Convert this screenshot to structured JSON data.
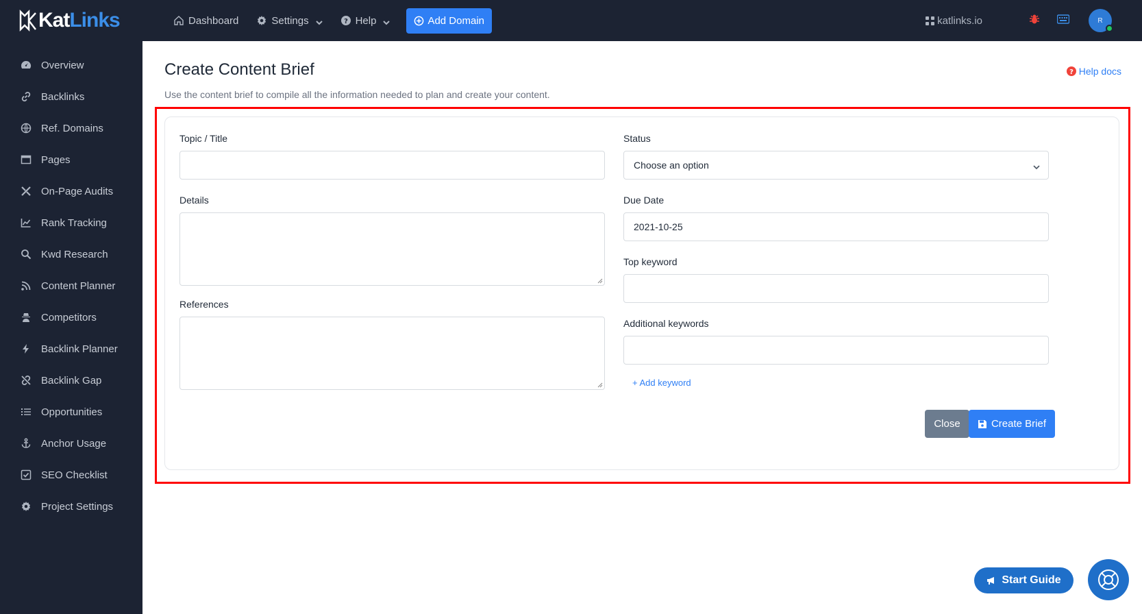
{
  "brand": {
    "name_a": "Kat",
    "name_b": "Links"
  },
  "sidebar": {
    "items": [
      {
        "label": "Overview",
        "icon": "gauge-icon"
      },
      {
        "label": "Backlinks",
        "icon": "link-icon"
      },
      {
        "label": "Ref. Domains",
        "icon": "globe-icon"
      },
      {
        "label": "Pages",
        "icon": "window-icon"
      },
      {
        "label": "On-Page Audits",
        "icon": "tools-icon"
      },
      {
        "label": "Rank Tracking",
        "icon": "chart-line-icon"
      },
      {
        "label": "Kwd Research",
        "icon": "search-icon"
      },
      {
        "label": "Content Planner",
        "icon": "rss-icon"
      },
      {
        "label": "Competitors",
        "icon": "user-secret-icon"
      },
      {
        "label": "Backlink Planner",
        "icon": "bolt-icon"
      },
      {
        "label": "Backlink Gap",
        "icon": "unlink-icon"
      },
      {
        "label": "Opportunities",
        "icon": "list-icon"
      },
      {
        "label": "Anchor Usage",
        "icon": "anchor-icon"
      },
      {
        "label": "SEO Checklist",
        "icon": "checkbox-icon"
      },
      {
        "label": "Project Settings",
        "icon": "gear-icon"
      }
    ]
  },
  "topbar": {
    "dashboard": "Dashboard",
    "settings": "Settings",
    "help": "Help",
    "add_domain": "Add Domain",
    "site": "katlinks.io",
    "avatar_initial": "R"
  },
  "page": {
    "title": "Create Content Brief",
    "subtitle": "Use the content brief to compile all the information needed to plan and create your content.",
    "help_docs": "Help docs"
  },
  "form": {
    "topic_label": "Topic / Title",
    "topic_value": "",
    "details_label": "Details",
    "references_label": "References",
    "status_label": "Status",
    "status_value": "Choose an option",
    "due_date_label": "Due Date",
    "due_date_value": "2021-10-25",
    "top_keyword_label": "Top keyword",
    "additional_keywords_label": "Additional keywords",
    "add_keyword": "+ Add keyword",
    "close": "Close",
    "create": "Create Brief"
  },
  "widgets": {
    "start_guide": "Start Guide"
  },
  "colors": {
    "sidebar_bg": "#1c2333",
    "accent": "#2f7ff5",
    "highlight": "#ff0000",
    "close_btn": "#6c7c8f"
  }
}
